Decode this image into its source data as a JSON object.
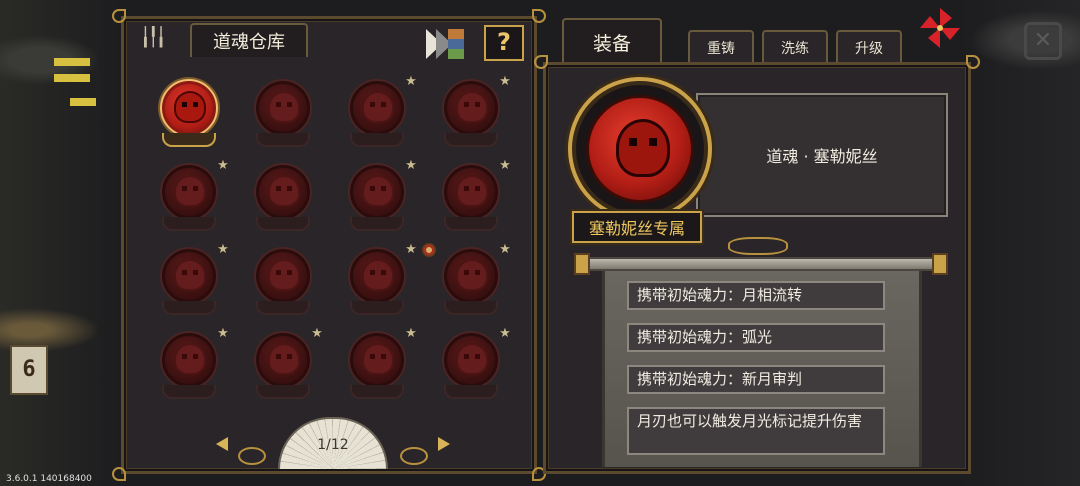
{
  "left_panel": {
    "title": "道魂仓库",
    "help_label": "?",
    "pager": {
      "label": "1/12"
    },
    "slots": [
      {
        "star": false,
        "selected": true
      },
      {
        "star": false,
        "selected": false
      },
      {
        "star": true,
        "selected": false
      },
      {
        "star": true,
        "selected": false
      },
      {
        "star": true,
        "selected": false
      },
      {
        "star": false,
        "selected": false
      },
      {
        "star": true,
        "selected": false
      },
      {
        "star": true,
        "selected": false
      },
      {
        "star": true,
        "selected": false
      },
      {
        "star": false,
        "selected": false
      },
      {
        "star": true,
        "selected": false
      },
      {
        "star": true,
        "selected": false
      },
      {
        "star": true,
        "selected": false
      },
      {
        "star": true,
        "selected": false
      },
      {
        "star": true,
        "selected": false
      },
      {
        "star": true,
        "selected": false
      }
    ]
  },
  "tabs": {
    "equip": "装备",
    "reforge": "重铸",
    "refine": "洗练",
    "upgrade": "升级"
  },
  "item": {
    "name": "道魂 · 塞勒妮丝",
    "exclusive": "塞勒妮丝专属",
    "abilities": [
      "携带初始魂力：月相流转",
      "携带初始魂力：弧光",
      "携带初始魂力：新月审判",
      "月刃也可以触发月光标记提升伤害"
    ]
  },
  "version": "3.6.0.1 140168400",
  "colors": {
    "gold": "#c9a24a",
    "orb_red": "#b21e16",
    "panel_bg": "#2a2528"
  },
  "icons": {
    "feather": "feather-icon",
    "sort": "sort-icon",
    "help": "help-icon",
    "pinwheel": "pinwheel-icon",
    "star": "star-icon"
  }
}
